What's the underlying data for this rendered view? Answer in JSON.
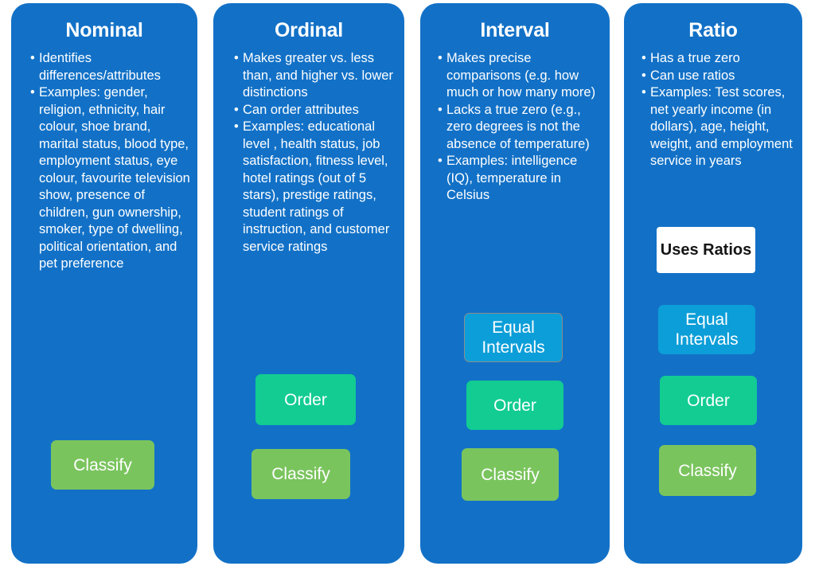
{
  "colors": {
    "panel_blue": "#1271c7",
    "classify_green": "#7ac45e",
    "order_teal": "#12cc92",
    "equal_intervals_blue": "#0c9ed8",
    "uses_ratios_bg": "#ffffff",
    "uses_ratios_text": "#151515",
    "text_white": "#ffffff",
    "background": "#ffffff"
  },
  "columns": [
    {
      "title": "Nominal",
      "bullets": [
        "Identifies differences/attributes",
        "Examples: gender, religion, ethnicity, hair colour, shoe brand, marital status, blood type, employment status, eye colour, favourite television show, presence of children, gun ownership, smoker, type of dwelling, political orientation, and pet preference"
      ],
      "buttons": [
        {
          "label": "Classify",
          "style": "classify"
        }
      ]
    },
    {
      "title": "Ordinal",
      "bullets": [
        "Makes greater vs. less than, and higher vs. lower distinctions",
        "Can order attributes",
        "Examples: educational level , health status, job satisfaction, fitness level, hotel ratings (out of 5 stars), prestige ratings, student ratings of instruction, and customer service ratings"
      ],
      "buttons": [
        {
          "label": "Order",
          "style": "order"
        },
        {
          "label": "Classify",
          "style": "classify"
        }
      ]
    },
    {
      "title": "Interval",
      "bullets": [
        "Makes precise comparisons (e.g. how much or how many more)",
        "Lacks a true zero (e.g., zero degrees is not the  absence of temperature)",
        "Examples: intelligence (IQ), temperature in Celsius"
      ],
      "buttons": [
        {
          "label": "Equal Intervals",
          "style": "equal"
        },
        {
          "label": "Order",
          "style": "order"
        },
        {
          "label": "Classify",
          "style": "classify"
        }
      ]
    },
    {
      "title": "Ratio",
      "bullets": [
        "Has a true zero",
        "Can use ratios",
        "Examples: Test scores, net yearly income (in dollars), age, height, weight, and employment service in years"
      ],
      "buttons": [
        {
          "label": "Uses Ratios",
          "style": "ratios"
        },
        {
          "label": "Equal Intervals",
          "style": "equal"
        },
        {
          "label": "Order",
          "style": "order"
        },
        {
          "label": "Classify",
          "style": "classify"
        }
      ]
    }
  ]
}
